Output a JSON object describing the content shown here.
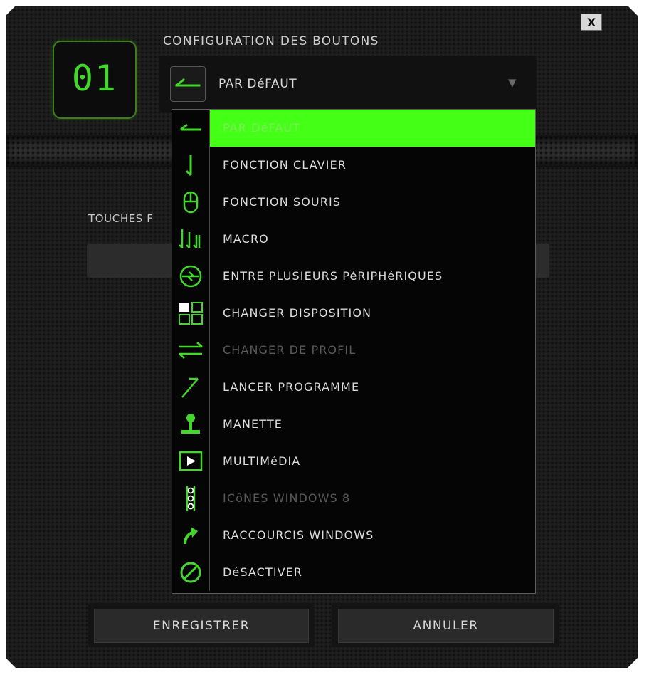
{
  "window": {
    "close_label": "X"
  },
  "slot": {
    "number": "01"
  },
  "config": {
    "title": "CONFIGURATION DES BOUTONS",
    "selected_value": "PAR DéFAUT",
    "selected_icon": "arrow-left-icon",
    "arrow": "▼"
  },
  "background_section": {
    "touches_label": "TOUCHES F"
  },
  "dropdown": {
    "items": [
      {
        "label": "PAR DéFAUT",
        "icon": "arrow-left-icon",
        "state": "selected"
      },
      {
        "label": "FONCTION CLAVIER",
        "icon": "keyboard-arrow-down-icon",
        "state": "normal"
      },
      {
        "label": "FONCTION SOURIS",
        "icon": "mouse-icon",
        "state": "normal"
      },
      {
        "label": "MACRO",
        "icon": "macro-icon",
        "state": "normal"
      },
      {
        "label": "ENTRE PLUSIEURS PéRIPHéRIQUES",
        "icon": "inter-device-icon",
        "state": "normal"
      },
      {
        "label": "CHANGER DISPOSITION",
        "icon": "switch-layout-icon",
        "state": "normal"
      },
      {
        "label": "CHANGER DE PROFIL",
        "icon": "switch-profile-icon",
        "state": "disabled"
      },
      {
        "label": "LANCER PROGRAMME",
        "icon": "launch-program-icon",
        "state": "normal"
      },
      {
        "label": "MANETTE",
        "icon": "joystick-icon",
        "state": "normal"
      },
      {
        "label": "MULTIMéDIA",
        "icon": "multimedia-icon",
        "state": "normal"
      },
      {
        "label": "ICôNES WINDOWS 8",
        "icon": "windows8-charms-icon",
        "state": "disabled"
      },
      {
        "label": "RACCOURCIS WINDOWS",
        "icon": "windows-shortcut-icon",
        "state": "normal"
      },
      {
        "label": "DéSACTIVER",
        "icon": "disable-icon",
        "state": "normal"
      }
    ]
  },
  "footer": {
    "save_label": "ENREGISTRER",
    "cancel_label": "ANNULER"
  },
  "colors": {
    "accent": "#44d62c",
    "highlight": "#44ff16",
    "panel": "#1b1b1b",
    "disabled_text": "#5a5a5a"
  }
}
